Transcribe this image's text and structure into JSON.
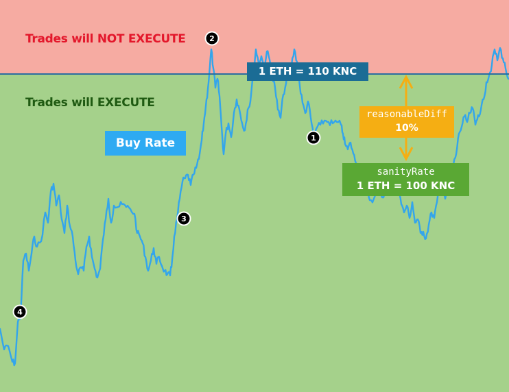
{
  "colors": {
    "not_execute_zone": "#f6aba2",
    "execute_zone": "#a5d18b",
    "threshold_line": "#2a6d9f",
    "buy_rate_line": "#33a5ec",
    "reasonable_diff": "#f5ae13",
    "sanity_rate": "#5aa834",
    "not_execute_text": "#e3172b",
    "execute_text": "#1f5a12",
    "marker": "#000000"
  },
  "zones": {
    "not_execute": {
      "prefix": "Trades will",
      "emphasis": "NOT EXECUTE"
    },
    "execute": {
      "prefix": "Trades will",
      "emphasis": "EXECUTE"
    }
  },
  "buy_rate": {
    "label": "Buy Rate"
  },
  "threshold": {
    "label": "1 ETH = 110 KNC"
  },
  "reasonable_diff": {
    "name": "reasonableDiff",
    "value": "10%"
  },
  "sanity_rate": {
    "name": "sanityRate",
    "value": "1 ETH = 100 KNC"
  },
  "markers": [
    {
      "label": "1"
    },
    {
      "label": "2"
    },
    {
      "label": "3"
    },
    {
      "label": "4"
    }
  ]
}
